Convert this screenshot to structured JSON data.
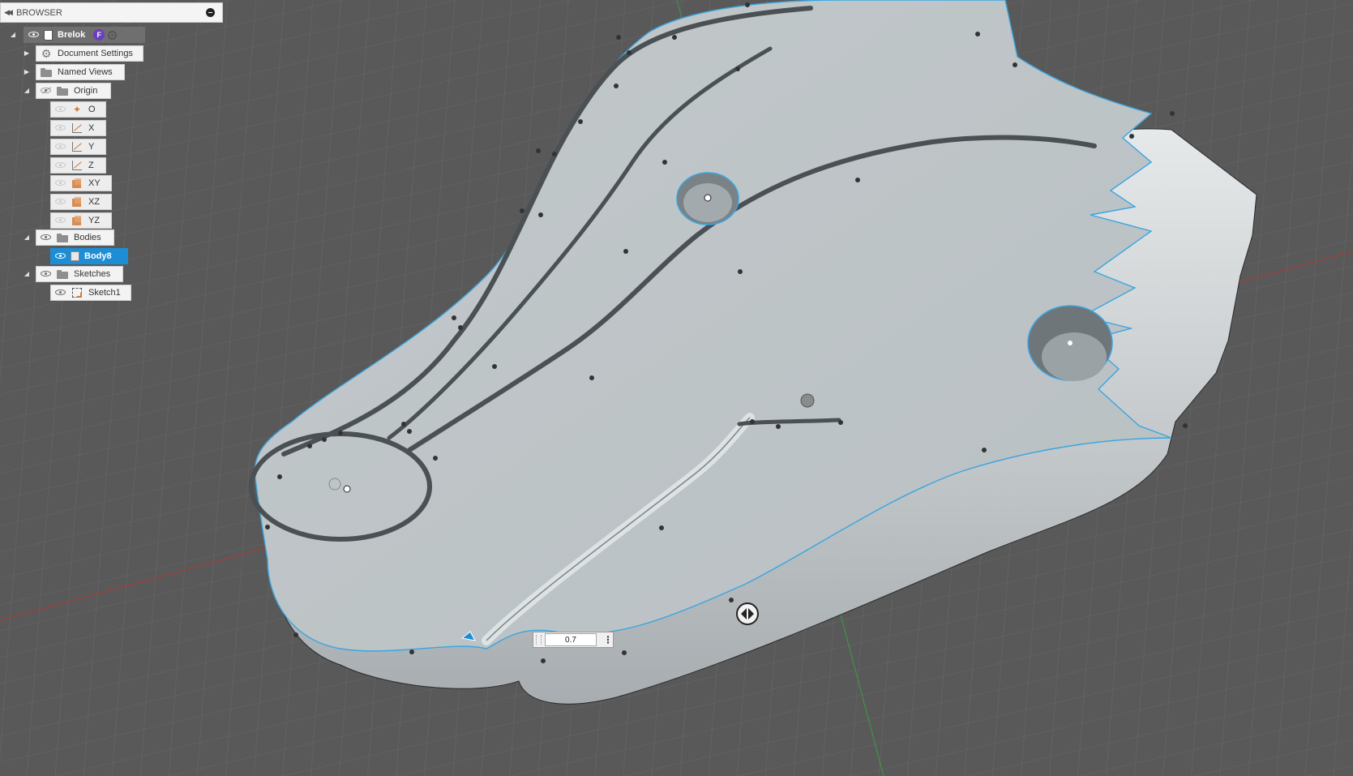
{
  "browser": {
    "title": "BROWSER",
    "root": {
      "label": "Brelok",
      "badge": "F"
    },
    "document_settings": "Document Settings",
    "named_views": "Named Views",
    "origin": {
      "label": "Origin",
      "items": [
        "O",
        "X",
        "Y",
        "Z",
        "XY",
        "XZ",
        "YZ"
      ]
    },
    "bodies": {
      "label": "Bodies",
      "items": [
        "Body8"
      ]
    },
    "sketches": {
      "label": "Sketches",
      "items": [
        "Sketch1"
      ]
    }
  },
  "viewport": {
    "background": "#595959",
    "model_color": "#c8cdcf",
    "edge_highlight": "#3aa5e0",
    "x_axis_color": "#c0392b",
    "y_axis_color": "#2e9e3e"
  },
  "value_input": {
    "value": "0.7"
  }
}
